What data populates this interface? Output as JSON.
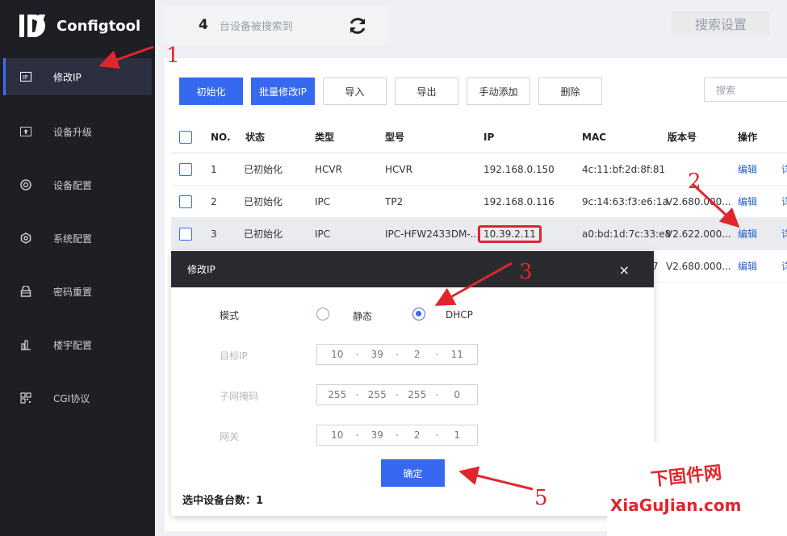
{
  "app": {
    "name": "Configtool"
  },
  "sidebar": {
    "items": [
      {
        "label": "修改IP",
        "icon": "ip-icon",
        "active": true
      },
      {
        "label": "设备升级",
        "icon": "upgrade-icon"
      },
      {
        "label": "设备配置",
        "icon": "config-icon"
      },
      {
        "label": "系统配置",
        "icon": "system-icon"
      },
      {
        "label": "密码重置",
        "icon": "lock-icon"
      },
      {
        "label": "楼宇配置",
        "icon": "building-icon"
      },
      {
        "label": "CGI协议",
        "icon": "qr-icon"
      }
    ]
  },
  "topbar": {
    "count": "4",
    "count_label": "台设备被搜索到",
    "search_settings": "搜索设置"
  },
  "toolbar": {
    "init": "初始化",
    "batch_modify_ip": "批量修改IP",
    "import": "导入",
    "export": "导出",
    "manual_add": "手动添加",
    "delete": "删除",
    "search_placeholder": "搜索"
  },
  "table": {
    "headers": {
      "no": "NO.",
      "status": "状态",
      "type": "类型",
      "model": "型号",
      "ip": "IP",
      "mac": "MAC",
      "version": "版本号",
      "action": "操作"
    },
    "rows": [
      {
        "no": "1",
        "status": "已初始化",
        "type": "HCVR",
        "model": "HCVR",
        "ip": "192.168.0.150",
        "mac": "4c:11:bf:2d:8f:81",
        "version": "",
        "action": "编辑",
        "extra": "详"
      },
      {
        "no": "2",
        "status": "已初始化",
        "type": "IPC",
        "model": "TP2",
        "ip": "192.168.0.116",
        "mac": "9c:14:63:f3:e6:1a",
        "version": "V2.680.000...",
        "action": "编辑",
        "extra": "详"
      },
      {
        "no": "3",
        "status": "已初始化",
        "type": "IPC",
        "model": "IPC-HFW2433DM-...",
        "ip": "10.39.2.11",
        "mac": "a0:bd:1d:7c:33:e8",
        "version": "V2.622.000...",
        "action": "编辑",
        "extra": "详"
      },
      {
        "no": "",
        "status": "",
        "type": "",
        "model": "",
        "ip": "",
        "mac": "7",
        "version": "V2.680.000...",
        "action": "编辑",
        "extra": "详"
      }
    ]
  },
  "modal": {
    "title": "修改IP",
    "close": "×",
    "mode_label": "模式",
    "static_label": "静态",
    "dhcp_label": "DHCP",
    "target_ip_label": "目标IP",
    "subnet_label": "子网掩码",
    "gateway_label": "网关",
    "target_ip": [
      "10",
      "39",
      "2",
      "11"
    ],
    "subnet": [
      "255",
      "255",
      "255",
      "0"
    ],
    "gateway": [
      "10",
      "39",
      "2",
      "1"
    ],
    "ok": "确定",
    "selected_count_label": "选中设备台数：",
    "selected_count": "1"
  },
  "annotations": {
    "n1": "1",
    "n2": "2",
    "n3": "3",
    "n5": "5"
  },
  "watermark": {
    "cn": "下固件网",
    "en": "XiaGuJian.com"
  },
  "colors": {
    "accent": "#3769f0",
    "annotation": "#e0262c",
    "sidebar_bg": "#1e1f24"
  }
}
